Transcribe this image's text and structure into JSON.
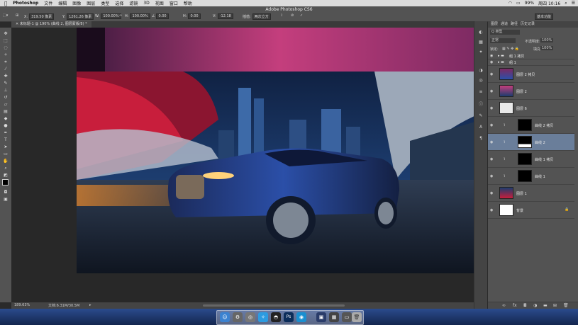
{
  "menubar": {
    "app_name": "Photoshop",
    "menus": [
      "文件",
      "编辑",
      "图像",
      "图层",
      "类型",
      "选择",
      "滤镜",
      "3D",
      "视图",
      "窗口",
      "帮助"
    ],
    "battery": "99%",
    "clock": "周四 10:16"
  },
  "window_title": "Adobe Photoshop CS6",
  "options": {
    "x_label": "X:",
    "x_value": "319.50 像素",
    "y_label": "Y:",
    "y_value": "1261.26 像素",
    "w_label": "W:",
    "w_value": "100.00%",
    "h_label": "H:",
    "h_value": "100.00%",
    "angle_value": "0.00",
    "hskew_label": "H:",
    "hskew_value": "0.00",
    "vskew_label": "V:",
    "vskew_value": "-12.18",
    "interp_label": "插值:",
    "interp_value": "两次立方",
    "workspace": "基本功能"
  },
  "document": {
    "tab_label": "未标题-1 @ 190% (曲线 2, 图层蒙版/8) *",
    "zoom": "189.63%",
    "doc_info": "文档:6.31M/30.5M"
  },
  "layers_panel": {
    "tabs": [
      "图层",
      "通道",
      "路径",
      "历史记录"
    ],
    "kind_label": "Q 类型",
    "blend_mode": "正常",
    "opacity_label": "不透明度:",
    "opacity_value": "100%",
    "lock_label": "锁定:",
    "fill_label": "填充:",
    "fill_value": "100%",
    "layers": [
      {
        "name": "组 1 拷贝",
        "type": "group"
      },
      {
        "name": "组 1",
        "type": "group"
      },
      {
        "name": "图层 2 拷贝",
        "type": "image"
      },
      {
        "name": "图层 2",
        "type": "image"
      },
      {
        "name": "图层 6",
        "type": "white"
      },
      {
        "name": "曲线 2 拷贝",
        "type": "adjust"
      },
      {
        "name": "曲线 2",
        "type": "adjust",
        "selected": true
      },
      {
        "name": "曲线 1 拷贝",
        "type": "adjust"
      },
      {
        "name": "曲线 1",
        "type": "adjust"
      },
      {
        "name": "图层 1",
        "type": "image"
      },
      {
        "name": "背景",
        "type": "white"
      }
    ]
  },
  "colors": {
    "selection": "#6a7e9a",
    "panel": "#535353",
    "canvas_bg": "#282828"
  }
}
